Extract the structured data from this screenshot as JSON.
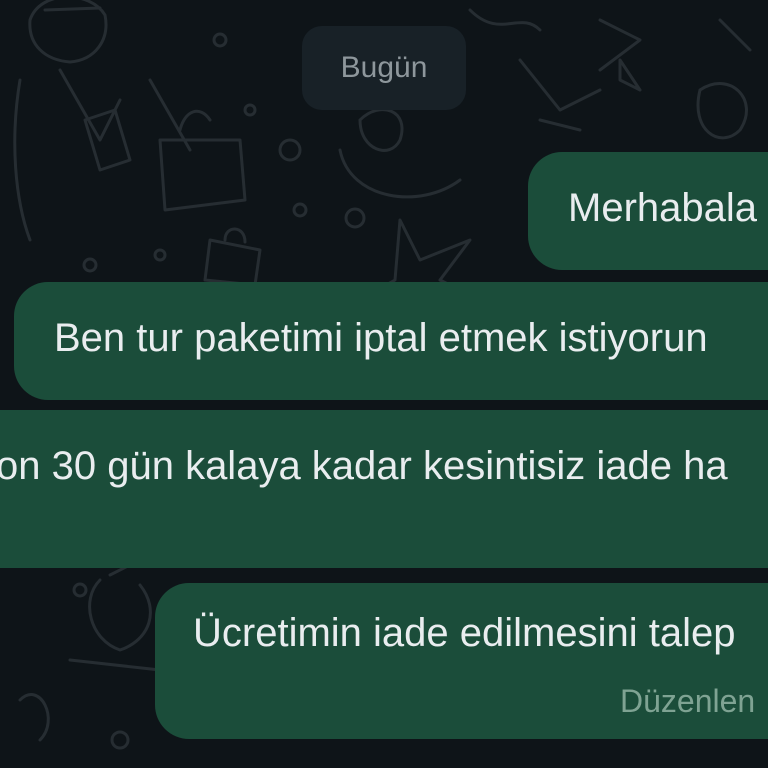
{
  "chat": {
    "date_separator": "Bugün",
    "messages": [
      {
        "text": "Merhabala"
      },
      {
        "text": "Ben tur paketimi iptal etmek istiyorun"
      },
      {
        "text": "on 30 gün kalaya kadar kesintisiz iade ha"
      },
      {
        "text": "Ücretimin iade edilmesini talep",
        "status": "Düzenlen"
      }
    ]
  },
  "colors": {
    "background": "#0e1418",
    "bubble": "#1b4d3a",
    "text": "#e9edef",
    "date_chip": "#182127"
  }
}
